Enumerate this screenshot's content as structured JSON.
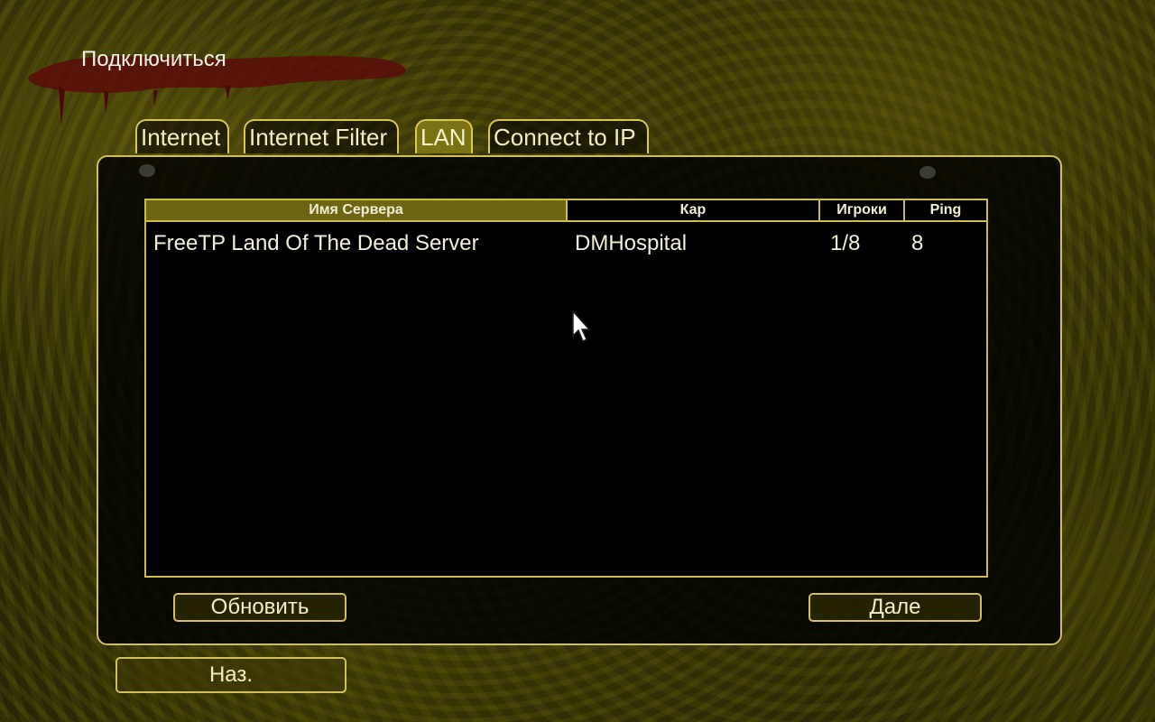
{
  "screen": {
    "title": "Подключиться"
  },
  "tabs": [
    {
      "label": "Internet",
      "active": false
    },
    {
      "label": "Internet Filter",
      "active": false
    },
    {
      "label": "LAN",
      "active": true
    },
    {
      "label": "Connect to IP",
      "active": false
    }
  ],
  "server_list": {
    "columns": [
      "Имя Сервера",
      "Кар",
      "Игроки",
      "Ping"
    ],
    "sorted_column": "Имя Сервера",
    "rows": [
      {
        "name": "FreeTP Land Of The Dead Server",
        "map": "DMHospital",
        "players": "1/8",
        "ping": "8"
      }
    ]
  },
  "buttons": {
    "refresh": "Обновить",
    "next": "Дале",
    "back": "Наз."
  },
  "colors": {
    "accent_border": "#cfc058",
    "active_tab": "#7a7214",
    "sorted_header": "#6e6414"
  }
}
